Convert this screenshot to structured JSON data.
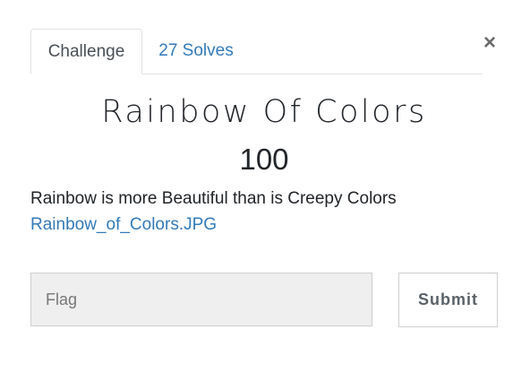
{
  "tabs": [
    {
      "label": "Challenge",
      "active": true
    },
    {
      "label": "27 Solves",
      "active": false
    }
  ],
  "close_symbol": "×",
  "challenge": {
    "name": "Rainbow Of Colors",
    "value": "100",
    "description": "Rainbow is more Beautiful than is Creepy Colors",
    "file_link": "Rainbow_of_Colors.JPG"
  },
  "form": {
    "flag_placeholder": "Flag",
    "flag_value": "",
    "submit_label": "Submit"
  },
  "colors": {
    "link": "#337ab7",
    "text": "#212529",
    "input_bg": "#efefef"
  }
}
